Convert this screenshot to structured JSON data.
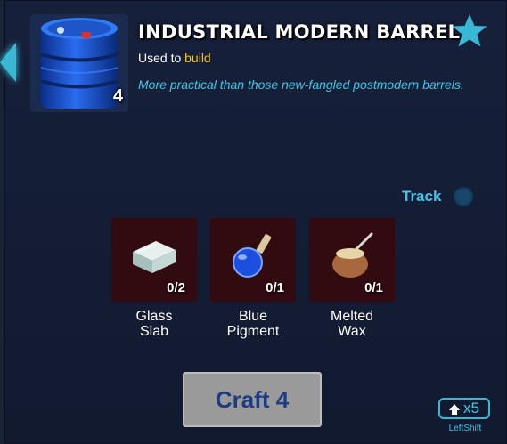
{
  "item": {
    "title": "INDUSTRIAL MODERN BARREL",
    "count": "4",
    "used_to_prefix": "Used to",
    "used_to_keyword": "build",
    "description": "More practical than those new-fangled postmodern barrels.",
    "icon": "blue-barrel-icon"
  },
  "favorite": {
    "icon": "star-icon",
    "color": "#39b8d6"
  },
  "track": {
    "label": "Track",
    "enabled": false
  },
  "ingredients": [
    {
      "name": "Glass\nSlab",
      "count": "0/2",
      "icon": "glass-slab-icon"
    },
    {
      "name": "Blue\nPigment",
      "count": "0/1",
      "icon": "blue-pigment-flask-icon"
    },
    {
      "name": "Melted\nWax",
      "count": "0/1",
      "icon": "melted-wax-pot-icon"
    }
  ],
  "craft": {
    "label": "Craft 4"
  },
  "modifier": {
    "multiplier": "x5",
    "key_label": "LeftShift",
    "icon": "shift-key-icon"
  },
  "colors": {
    "accent": "#3fc6e6",
    "keyword": "#f4c61b",
    "ingredient_bg": "#310b10",
    "craft_bg": "#9a9a9a",
    "craft_text": "#1d3d83"
  }
}
